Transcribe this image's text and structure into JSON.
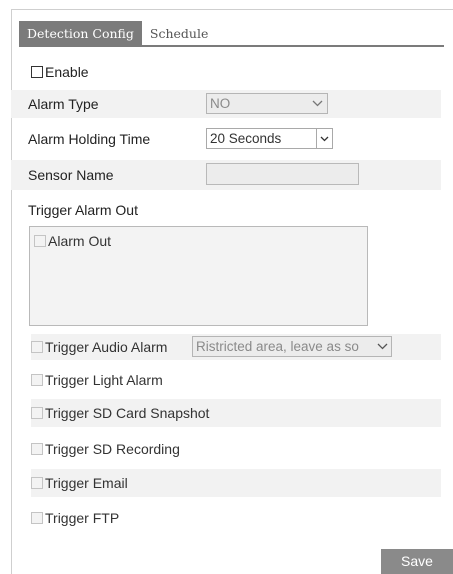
{
  "tabs": [
    {
      "label": "Detection Config",
      "active": true
    },
    {
      "label": "Schedule",
      "active": false
    }
  ],
  "enable": {
    "label": "Enable",
    "checked": false
  },
  "alarm_type": {
    "label": "Alarm Type",
    "value": "NO"
  },
  "alarm_holding_time": {
    "label": "Alarm Holding Time",
    "value": "20 Seconds"
  },
  "sensor_name": {
    "label": "Sensor Name",
    "value": ""
  },
  "trigger_alarm_out": {
    "label": "Trigger Alarm Out",
    "item_label": "Alarm Out"
  },
  "trigger_audio_alarm": {
    "label": "Trigger Audio Alarm",
    "value": "Ristricted area, leave as so"
  },
  "triggers": [
    {
      "label": "Trigger Light Alarm"
    },
    {
      "label": "Trigger SD Card Snapshot"
    },
    {
      "label": "Trigger SD Recording"
    },
    {
      "label": "Trigger Email"
    },
    {
      "label": "Trigger FTP"
    }
  ],
  "save_label": "Save",
  "colors": {
    "tab_active": "#7b7b7b",
    "row_shade": "#f2f2f2",
    "save_button": "#8a8a8a"
  }
}
